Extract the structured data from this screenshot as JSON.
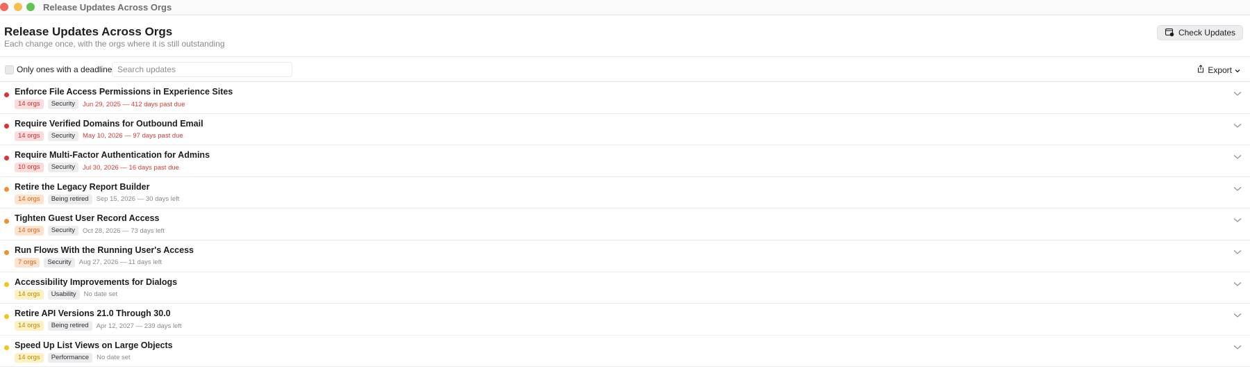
{
  "window": {
    "title": "Release Updates Across Orgs"
  },
  "header": {
    "title": "Release Updates Across Orgs",
    "subtitle": "Each change once, with the orgs where it is still outstanding",
    "check_button": "Check Updates"
  },
  "toolbar": {
    "checkbox_label": "Only ones with a deadline",
    "search_placeholder": "Search updates",
    "export_label": "Export"
  },
  "colors": {
    "red": "#e0302f",
    "orange": "#f0902e",
    "yellow": "#f0c419"
  },
  "updates": [
    {
      "title": "Enforce File Access Permissions in Experience Sites",
      "orgs": "14 orgs",
      "category": "Security",
      "date": "Jun 29, 2025 — 412 days past due",
      "severity": "red",
      "overdue": true
    },
    {
      "title": "Require Verified Domains for Outbound Email",
      "orgs": "14 orgs",
      "category": "Security",
      "date": "May 10, 2026 — 97 days past due",
      "severity": "red",
      "overdue": true
    },
    {
      "title": "Require Multi-Factor Authentication for Admins",
      "orgs": "10 orgs",
      "category": "Security",
      "date": "Jul 30, 2026 — 16 days past due",
      "severity": "red",
      "overdue": true
    },
    {
      "title": "Retire the Legacy Report Builder",
      "orgs": "14 orgs",
      "category": "Being retired",
      "date": "Sep 15, 2026 — 30 days left",
      "severity": "orange",
      "overdue": false
    },
    {
      "title": "Tighten Guest User Record Access",
      "orgs": "14 orgs",
      "category": "Security",
      "date": "Oct 28, 2026 — 73 days left",
      "severity": "orange",
      "overdue": false
    },
    {
      "title": "Run Flows With the Running User's Access",
      "orgs": "7 orgs",
      "category": "Security",
      "date": "Aug 27, 2026 — 11 days left",
      "severity": "orange",
      "overdue": false
    },
    {
      "title": "Accessibility Improvements for Dialogs",
      "orgs": "14 orgs",
      "category": "Usability",
      "date": "No date set",
      "severity": "yellow",
      "overdue": false
    },
    {
      "title": "Retire API Versions 21.0 Through 30.0",
      "orgs": "14 orgs",
      "category": "Being retired",
      "date": "Apr 12, 2027 — 239 days left",
      "severity": "yellow",
      "overdue": false
    },
    {
      "title": "Speed Up List Views on Large Objects",
      "orgs": "14 orgs",
      "category": "Performance",
      "date": "No date set",
      "severity": "yellow",
      "overdue": false
    }
  ]
}
